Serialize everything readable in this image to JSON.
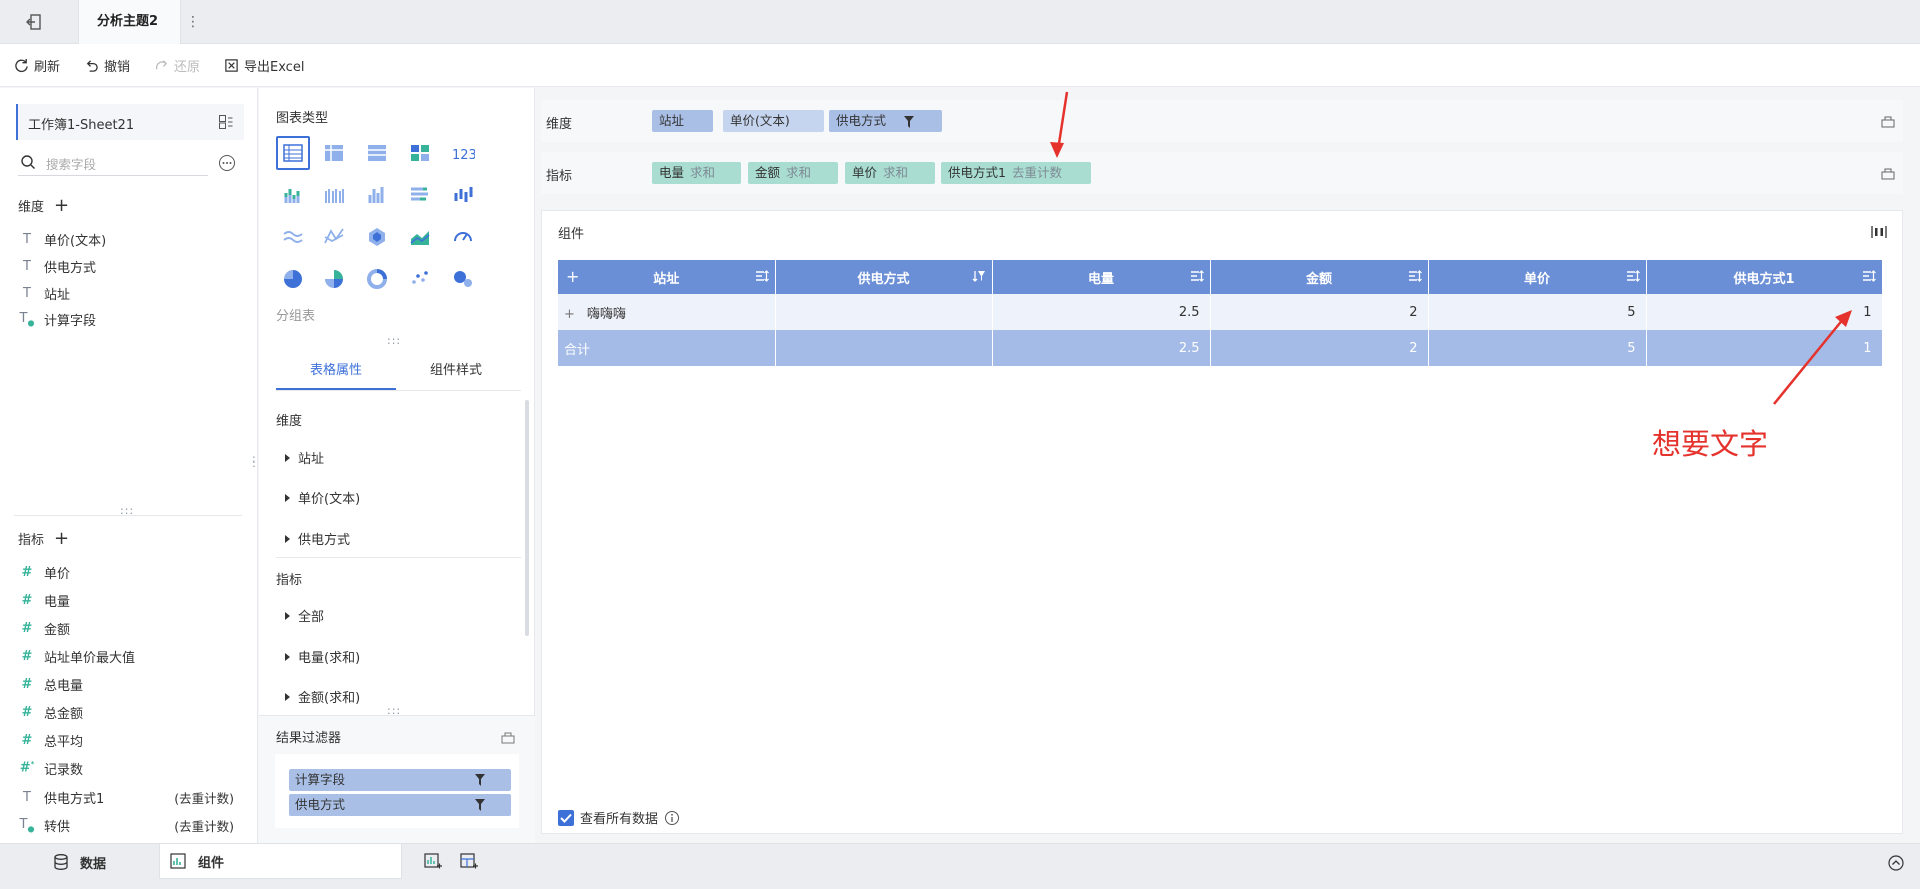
{
  "topbar": {
    "tab_title": "分析主题2",
    "more": "⋮"
  },
  "toolbar": {
    "refresh": "刷新",
    "undo": "撤销",
    "redo": "还原",
    "export": "导出Excel"
  },
  "fields": {
    "dataset": "工作簿1-Sheet21",
    "search_placeholder": "搜索字段",
    "dim_title": "维度",
    "dimensions": [
      "单价(文本)",
      "供电方式",
      "站址",
      "计算字段"
    ],
    "mea_title": "指标",
    "measures": [
      {
        "label": "单价",
        "suffix": ""
      },
      {
        "label": "电量",
        "suffix": ""
      },
      {
        "label": "金额",
        "suffix": ""
      },
      {
        "label": "站址单价最大值",
        "suffix": ""
      },
      {
        "label": "总电量",
        "suffix": ""
      },
      {
        "label": "总金额",
        "suffix": ""
      },
      {
        "label": "总平均",
        "suffix": ""
      },
      {
        "label": "记录数",
        "suffix": ""
      },
      {
        "label": "供电方式1",
        "suffix": "(去重计数)"
      },
      {
        "label": "转供",
        "suffix": "(去重计数)"
      }
    ]
  },
  "config": {
    "chart_type_title": "图表类型",
    "group_table": "分组表",
    "tab_props": "表格属性",
    "tab_style": "组件样式",
    "dim_label": "维度",
    "dim_items": [
      "站址",
      "单价(文本)",
      "供电方式"
    ],
    "mea_label": "指标",
    "mea_items": [
      "全部",
      "电量(求和)",
      "金额(求和)"
    ],
    "filter_title": "结果过滤器",
    "filters": [
      "计算字段",
      "供电方式"
    ]
  },
  "shelves": {
    "dim_label": "维度",
    "dim_pills": [
      "站址",
      "单价(文本)",
      "供电方式"
    ],
    "mea_label": "指标",
    "mea_pills": [
      {
        "name": "电量",
        "agg": "求和"
      },
      {
        "name": "金额",
        "agg": "求和"
      },
      {
        "name": "单价",
        "agg": "求和"
      },
      {
        "name": "供电方式1",
        "agg": "去重计数"
      }
    ]
  },
  "component": {
    "title": "组件",
    "columns": [
      "站址",
      "供电方式",
      "电量",
      "金额",
      "单价",
      "供电方式1"
    ],
    "rows": [
      {
        "cells": [
          "嗨嗨嗨",
          "",
          "2.5",
          "2",
          "5",
          "1"
        ]
      }
    ],
    "total": [
      "合计",
      "",
      "2.5",
      "2",
      "5",
      "1"
    ],
    "show_all": "查看所有数据",
    "annotation": "想要文字"
  },
  "bottom": {
    "data_tab": "数据",
    "component_tab": "组件"
  },
  "colors": {
    "accent": "#3d71d8",
    "header": "#6b8fd6",
    "total": "#a3bbe6",
    "dim_pill": "#a9bfe6",
    "mea_pill": "#a9ddd2",
    "annotation": "#e5322d"
  }
}
